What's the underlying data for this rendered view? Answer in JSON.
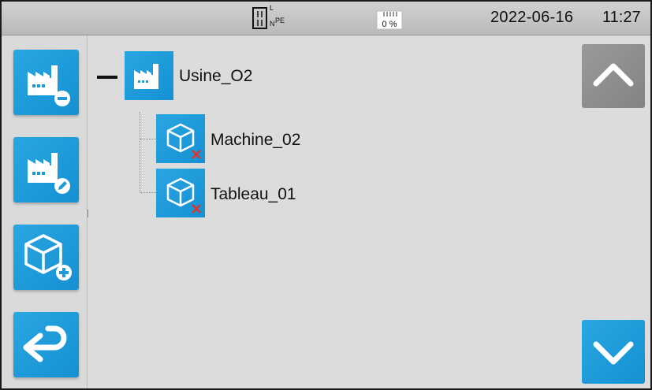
{
  "status_bar": {
    "connection_icon": "L-N-PE-connection-icon",
    "connection_labels": {
      "l": "L",
      "n": "N",
      "pe": "PE"
    },
    "memory_icon": "sd-card-icon",
    "memory_usage": "0 %",
    "date": "2022-06-16",
    "time": "11:27"
  },
  "sidebar": {
    "buttons": [
      {
        "icon": "remove-site-icon"
      },
      {
        "icon": "edit-site-icon"
      },
      {
        "icon": "add-object-icon"
      },
      {
        "icon": "back-icon"
      }
    ]
  },
  "tree": {
    "root": {
      "icon": "factory-icon",
      "label": "Usine_O2",
      "expanded": true
    },
    "children": [
      {
        "icon": "cube-icon",
        "label": "Machine_02",
        "status_icon": "error-cross-icon"
      },
      {
        "icon": "cube-icon",
        "label": "Tableau_01",
        "status_icon": "error-cross-icon"
      }
    ]
  },
  "scroll": {
    "up_icon": "chevron-up-icon",
    "down_icon": "chevron-down-icon"
  },
  "colors": {
    "accent": "#1e9ad8",
    "disabled": "#8f8f8f",
    "error": "#e0342a",
    "background": "#dcdcdc"
  }
}
